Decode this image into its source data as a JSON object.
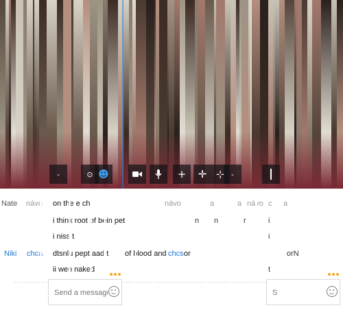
{
  "colors": {
    "accent_blue": "#1e74d6",
    "typing_orange": "#f5a623"
  },
  "call_controls": {
    "items": [
      {
        "name": "expand-icon",
        "glyph": "-"
      },
      {
        "name": "screen-share-icon",
        "glyph": "⊙"
      },
      {
        "name": "participants-icon",
        "glyph": "☻"
      },
      {
        "name": "video-icon",
        "glyph": ""
      },
      {
        "name": "mic-icon",
        "glyph": ""
      },
      {
        "name": "add-icon",
        "glyph": "+"
      },
      {
        "name": "hold-icon",
        "glyph": "✛"
      },
      {
        "name": "volume-icon",
        "glyph": "⊹"
      },
      {
        "name": "more-icon",
        "glyph": "-"
      },
      {
        "name": "end-call-icon",
        "glyph": "⟋"
      }
    ]
  },
  "chat": {
    "messages": [
      {
        "sender": "Nate",
        "sender_type": "self",
        "text": "on the e ch",
        "ghost": "návo"
      },
      {
        "sender": "",
        "sender_type": "self",
        "text": "i think root of bein pet",
        "ghost": ""
      },
      {
        "sender": "",
        "sender_type": "self",
        "text": "i niss t",
        "ghost": ""
      },
      {
        "sender": "Niki",
        "sender_type": "peer",
        "text": "dtsnlu pept aad t",
        "text2": "of blood and",
        "text3": "chcs",
        "text4": "or",
        "ghost": "chca"
      },
      {
        "sender": "",
        "sender_type": "self",
        "text": "ii wen naked",
        "ghost": ""
      }
    ],
    "ghost_columns": [
      "návo",
      "a",
      "a",
      "návo",
      "c",
      "a",
      "i",
      "i",
      "t",
      "orN"
    ],
    "compose": {
      "left_placeholder": "Send a message",
      "right_placeholder": "S"
    }
  }
}
